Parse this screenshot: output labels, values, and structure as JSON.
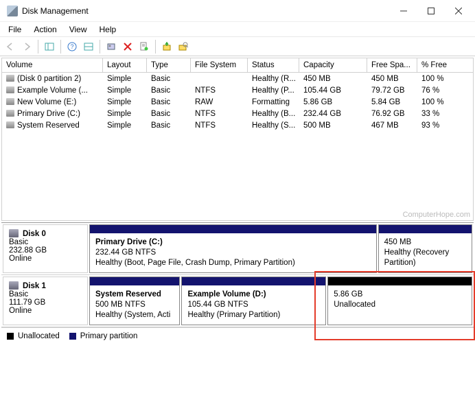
{
  "window": {
    "title": "Disk Management"
  },
  "menu": {
    "file": "File",
    "action": "Action",
    "view": "View",
    "help": "Help"
  },
  "columns": {
    "volume": "Volume",
    "layout": "Layout",
    "type": "Type",
    "fs": "File System",
    "status": "Status",
    "capacity": "Capacity",
    "free": "Free Spa...",
    "pctfree": "% Free"
  },
  "rows": [
    {
      "name": "(Disk 0 partition 2)",
      "layout": "Simple",
      "type": "Basic",
      "fs": "",
      "status": "Healthy (R...",
      "capacity": "450 MB",
      "free": "450 MB",
      "pctfree": "100 %"
    },
    {
      "name": "Example Volume (...",
      "layout": "Simple",
      "type": "Basic",
      "fs": "NTFS",
      "status": "Healthy (P...",
      "capacity": "105.44 GB",
      "free": "79.72 GB",
      "pctfree": "76 %"
    },
    {
      "name": "New Volume (E:)",
      "layout": "Simple",
      "type": "Basic",
      "fs": "RAW",
      "status": "Formatting",
      "capacity": "5.86 GB",
      "free": "5.84 GB",
      "pctfree": "100 %"
    },
    {
      "name": "Primary Drive (C:)",
      "layout": "Simple",
      "type": "Basic",
      "fs": "NTFS",
      "status": "Healthy (B...",
      "capacity": "232.44 GB",
      "free": "76.92 GB",
      "pctfree": "33 %"
    },
    {
      "name": "System Reserved",
      "layout": "Simple",
      "type": "Basic",
      "fs": "NTFS",
      "status": "Healthy (S...",
      "capacity": "500 MB",
      "free": "467 MB",
      "pctfree": "93 %"
    }
  ],
  "disks": [
    {
      "name": "Disk 0",
      "type": "Basic",
      "size": "232.88 GB",
      "state": "Online",
      "partitions": [
        {
          "title": "Primary Drive  (C:)",
          "size": "232.44 GB NTFS",
          "status": "Healthy (Boot, Page File, Crash Dump, Primary Partition)",
          "kind": "primary",
          "flex": 4
        },
        {
          "title": "",
          "size": "450 MB",
          "status": "Healthy (Recovery Partition)",
          "kind": "primary",
          "flex": 1.3
        }
      ]
    },
    {
      "name": "Disk 1",
      "type": "Basic",
      "size": "111.79 GB",
      "state": "Online",
      "partitions": [
        {
          "title": "System Reserved",
          "size": "500 MB NTFS",
          "status": "Healthy (System, Acti",
          "kind": "primary",
          "flex": 1
        },
        {
          "title": "Example Volume  (D:)",
          "size": "105.44 GB NTFS",
          "status": "Healthy (Primary Partition)",
          "kind": "primary",
          "flex": 1.6
        },
        {
          "title": "",
          "size": "5.86 GB",
          "status": "Unallocated",
          "kind": "unalloc",
          "flex": 1.6
        }
      ]
    }
  ],
  "legend": {
    "unallocated": "Unallocated",
    "primary": "Primary partition"
  },
  "colors": {
    "primary_bar": "#13136e",
    "unallocated_bar": "#000000",
    "highlight": "#e43b2a"
  },
  "watermark": "ComputerHope.com"
}
